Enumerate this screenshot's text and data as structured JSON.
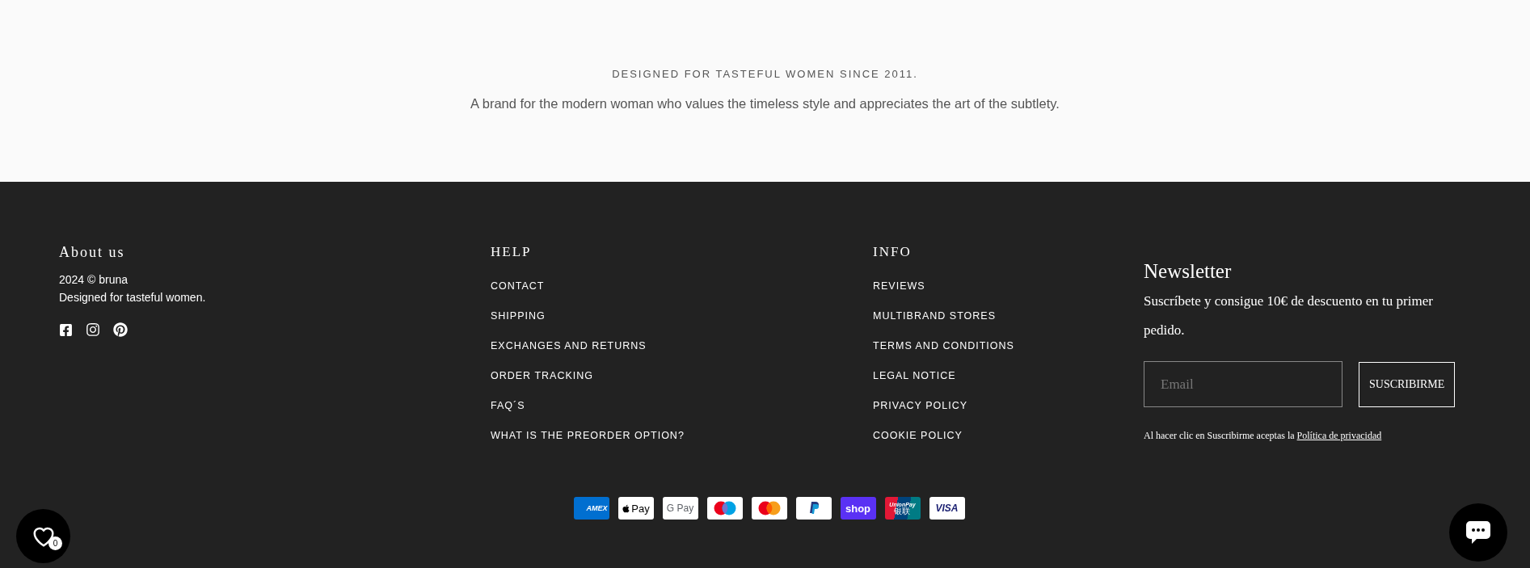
{
  "banner": {
    "eyebrow": "DESIGNED FOR TASTEFUL WOMEN SINCE 2011.",
    "tagline": "A brand for the modern woman who values the timeless style and appreciates the art of the subtlety."
  },
  "footer": {
    "about": {
      "heading": "About us",
      "lines": [
        "2024 © bruna",
        "Designed for tasteful women."
      ],
      "social": [
        {
          "kind": "facebook"
        },
        {
          "kind": "instagram"
        },
        {
          "kind": "pinterest"
        }
      ]
    },
    "columns": [
      {
        "heading": "HELP",
        "links": [
          "CONTACT",
          "SHIPPING",
          "EXCHANGES AND RETURNS",
          "ORDER TRACKING",
          "FAQ´S",
          "WHAT IS THE PREORDER OPTION?"
        ]
      },
      {
        "heading": "INFO",
        "links": [
          "REVIEWS",
          "MULTIBRAND STORES",
          "TERMS AND CONDITIONS",
          "LEGAL NOTICE",
          "PRIVACY POLICY",
          "COOKIE POLICY"
        ]
      }
    ],
    "newsletter": {
      "title": "Newsletter",
      "text": "Suscríbete y consigue 10€ de descuento en tu primer pedido.",
      "email": {
        "placeholder": "Email"
      },
      "button": "SUSCRIBIRME",
      "consent": "Al hacer clic en Suscribirme aceptas la",
      "consent_link": "Política de privacidad"
    },
    "payments": [
      {
        "kind": "amex",
        "labels": [
          "AMEX"
        ]
      },
      {
        "kind": "applepay",
        "labels": [
          "Pay"
        ]
      },
      {
        "kind": "googlepay",
        "labels": [
          "G Pay"
        ]
      },
      {
        "kind": "maestro"
      },
      {
        "kind": "mastercard"
      },
      {
        "kind": "paypal"
      },
      {
        "kind": "shop",
        "labels": [
          "shop"
        ]
      },
      {
        "kind": "unionpay",
        "labels": [
          "UnionPay",
          "银联"
        ]
      },
      {
        "kind": "visa",
        "labels": [
          "VISA"
        ]
      }
    ]
  },
  "wishlist": {
    "count": "0"
  }
}
